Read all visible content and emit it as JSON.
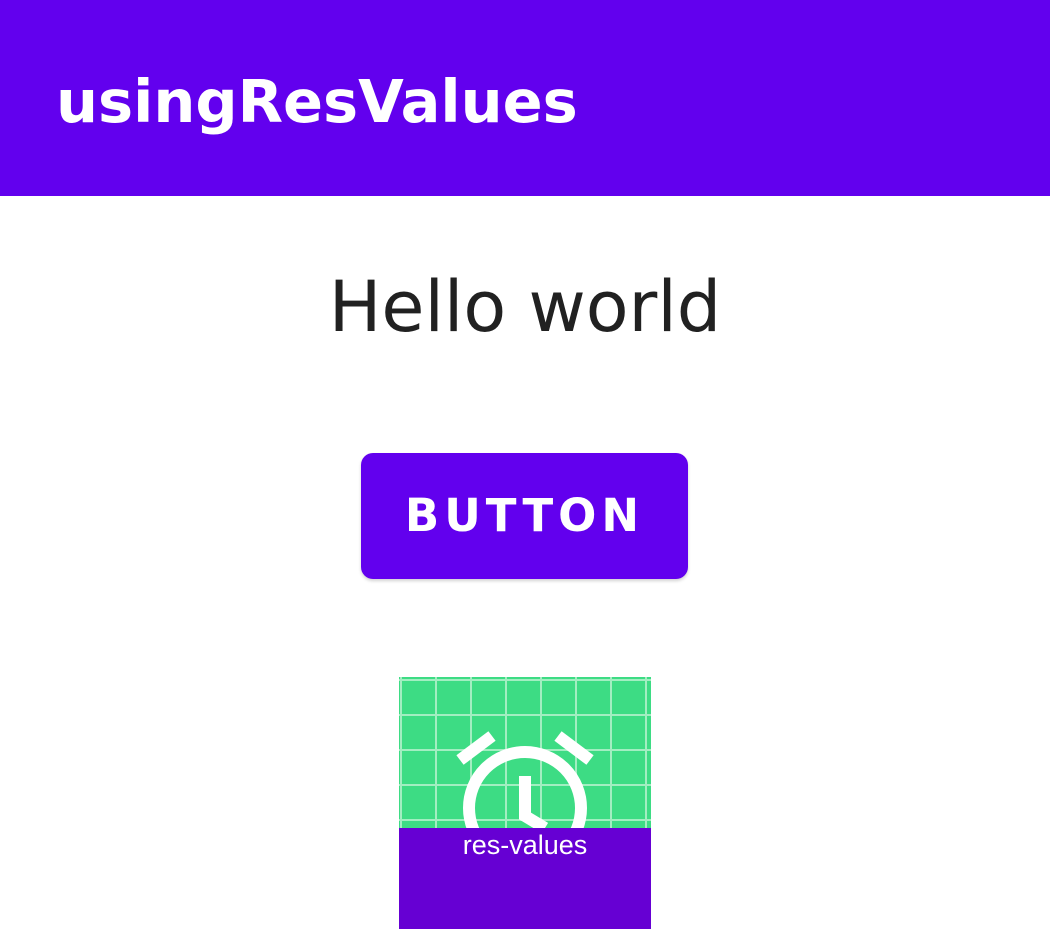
{
  "app_bar": {
    "title": "usingResValues",
    "color": "#6200ee"
  },
  "main": {
    "greeting": "Hello world",
    "button_label": "BUTTON",
    "icon": {
      "name": "alarm-clock-icon",
      "label": "res-values",
      "grid_color": "#3ddc84",
      "banner_color": "#6600d3"
    }
  }
}
